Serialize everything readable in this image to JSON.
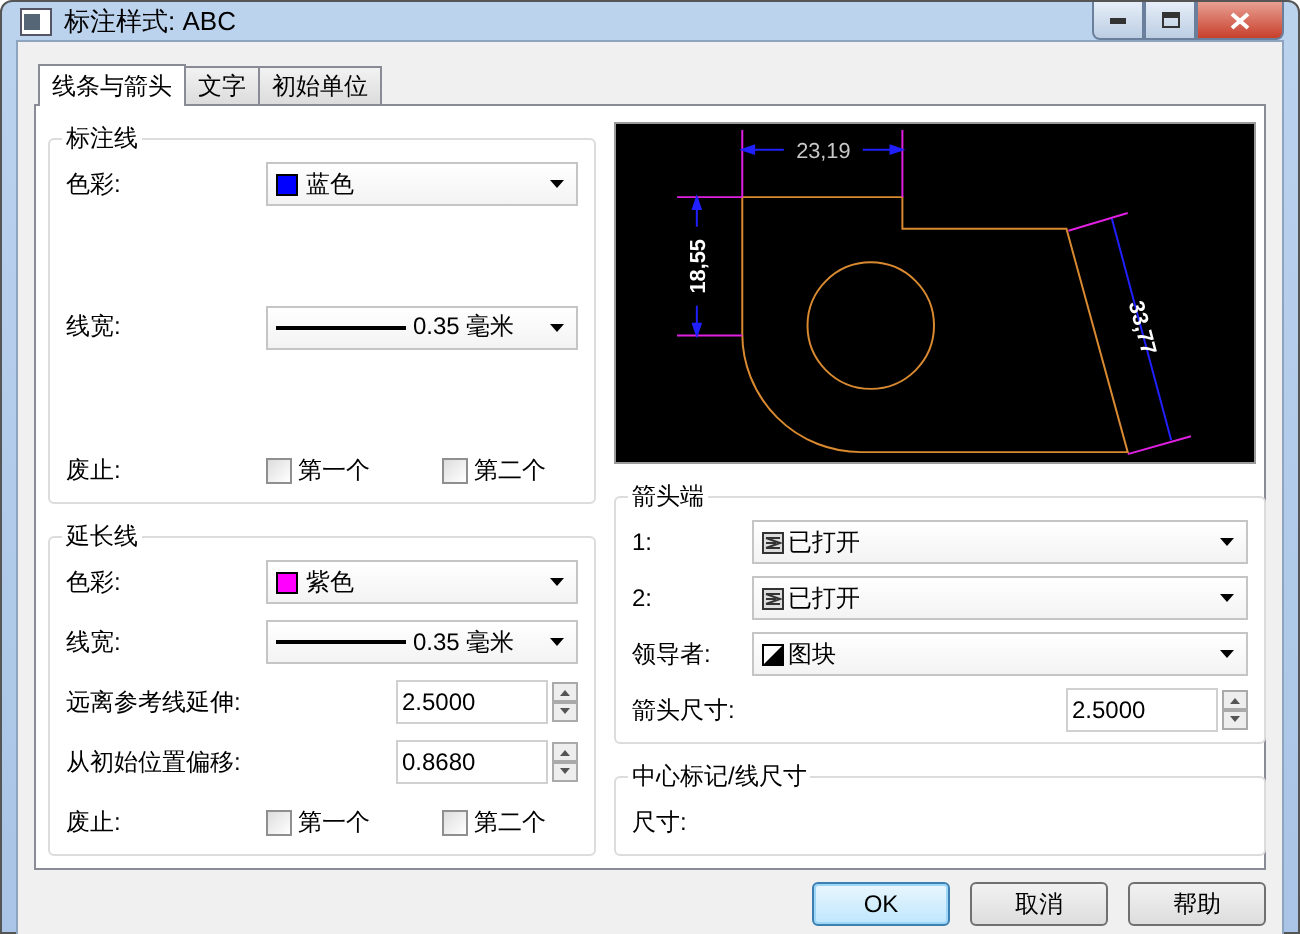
{
  "window": {
    "title": "标注样式: ABC"
  },
  "tabs": [
    {
      "label": "线条与箭头",
      "selected": true
    },
    {
      "label": "文字",
      "selected": false
    },
    {
      "label": "初始单位",
      "selected": false
    }
  ],
  "dimension_line": {
    "title": "标注线",
    "color": {
      "label": "色彩:",
      "value": "蓝色",
      "color": "#0000ff"
    },
    "lineweight": {
      "label": "线宽:",
      "value": "0.35 毫米"
    },
    "suppress": {
      "label": "废止:",
      "options": [
        {
          "label": "第一个",
          "checked": false
        },
        {
          "label": "第二个",
          "checked": false
        }
      ]
    }
  },
  "extension_line": {
    "title": "延长线",
    "color": {
      "label": "色彩:",
      "value": "紫色",
      "color": "#ff00ff"
    },
    "lineweight": {
      "label": "线宽:",
      "value": "0.35 毫米"
    },
    "extend": {
      "label": "远离参考线延伸:",
      "value": "2.5000"
    },
    "offset": {
      "label": "从初始位置偏移:",
      "value": "0.8680"
    },
    "suppress": {
      "label": "废止:",
      "options": [
        {
          "label": "第一个",
          "checked": false
        },
        {
          "label": "第二个",
          "checked": false
        }
      ]
    }
  },
  "preview": {
    "labels": [
      "23,19",
      "18,55",
      "33,77"
    ]
  },
  "arrowheads": {
    "title": "箭头端",
    "rows": [
      {
        "label": "1:",
        "value": "已打开",
        "kind": "open"
      },
      {
        "label": "2:",
        "value": "已打开",
        "kind": "open"
      },
      {
        "label": "领导者:",
        "value": "图块",
        "kind": "block"
      }
    ],
    "size": {
      "label": "箭头尺寸:",
      "value": "2.5000"
    }
  },
  "center_marks": {
    "title": "中心标记/线尺寸",
    "size": {
      "label": "尺寸:"
    }
  },
  "buttons": [
    {
      "label": "OK",
      "default": true
    },
    {
      "label": "取消",
      "default": false
    },
    {
      "label": "帮助",
      "default": false
    }
  ]
}
